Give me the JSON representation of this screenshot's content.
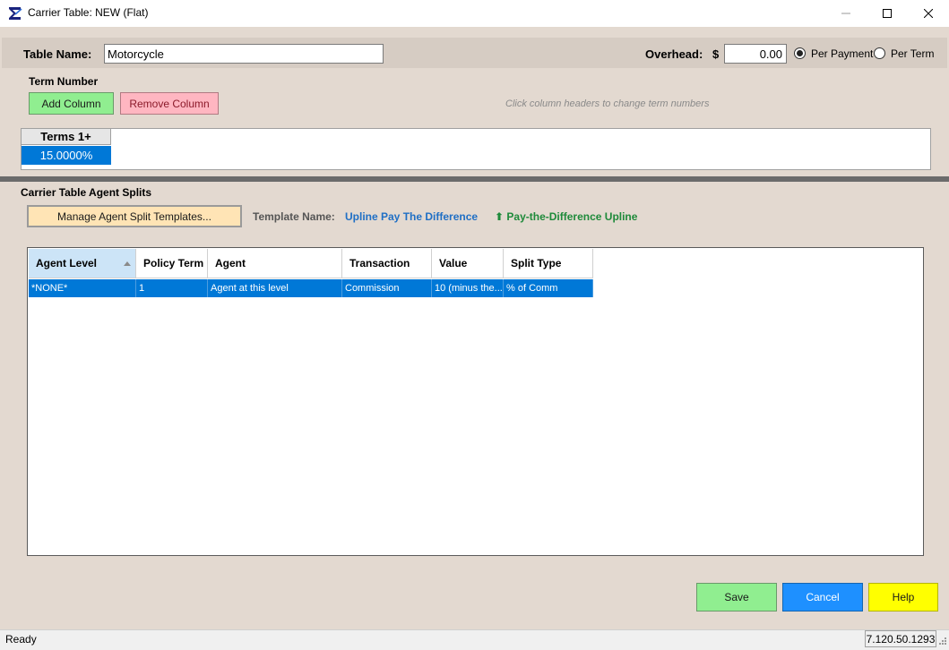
{
  "window": {
    "title": "Carrier Table: NEW (Flat)",
    "icon": "sigma-app-icon",
    "controls": {
      "minimize": "minimize-icon",
      "maximize": "maximize-icon",
      "close": "close-icon"
    }
  },
  "header": {
    "table_name_label": "Table Name:",
    "table_name_value": "Motorcycle",
    "overhead_label": "Overhead:",
    "currency_symbol": "$",
    "overhead_value": "0.00",
    "radio_options": [
      {
        "label": "Per Payment",
        "checked": true
      },
      {
        "label": "Per Term",
        "checked": false
      }
    ]
  },
  "term_section": {
    "label": "Term Number",
    "add_column_label": "Add Column",
    "remove_column_label": "Remove Column",
    "hint": "Click column headers to change term numbers",
    "columns": [
      {
        "header": "Terms 1+",
        "value": "15.0000%"
      }
    ]
  },
  "agent_splits": {
    "label": "Carrier Table Agent Splits",
    "manage_button_label": "Manage Agent Split Templates...",
    "template_name_label": "Template Name:",
    "template_name_value": "Upline Pay The Difference",
    "template_type_value": "Pay-the-Difference Upline",
    "template_type_icon": "arrow-up-icon",
    "grid": {
      "columns": [
        "Agent Level",
        "Policy Term",
        "Agent",
        "Transaction",
        "Value",
        "Split Type"
      ],
      "rows": [
        [
          "*NONE*",
          "1",
          "Agent at this level",
          "Commission",
          "10 (minus the...",
          "% of Comm"
        ]
      ]
    }
  },
  "footer": {
    "save_label": "Save",
    "cancel_label": "Cancel",
    "help_label": "Help"
  },
  "status": {
    "text": "Ready",
    "version": "7.120.50.1293"
  },
  "colors": {
    "selection": "#0078d7",
    "save": "#90ee90",
    "cancel": "#1e90ff",
    "help": "#ffff00",
    "remove": "#ffb6c1",
    "manage": "#ffe4b5",
    "template_name": "#1f6fc5",
    "template_type": "#1e8a3a"
  }
}
